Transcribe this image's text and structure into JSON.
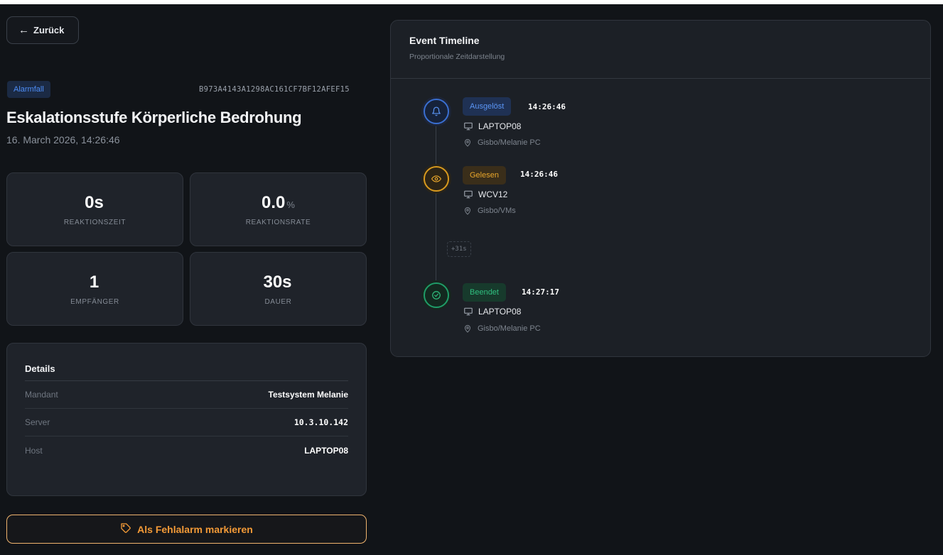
{
  "nav": {
    "back_label": "Zurück"
  },
  "alarm": {
    "type_badge": "Alarmfall",
    "id": "B973A4143A1298AC161CF7BF12AFEF15",
    "title": "Eskalationsstufe Körperliche Bedrohung",
    "date": "16. March 2026, 14:26:46"
  },
  "stats": [
    {
      "value": "0s",
      "unit": "",
      "label": "REAKTIONSZEIT"
    },
    {
      "value": "0.0",
      "unit": "%",
      "label": "REAKTIONSRATE"
    },
    {
      "value": "1",
      "unit": "",
      "label": "EMPFÄNGER"
    },
    {
      "value": "30s",
      "unit": "",
      "label": "DAUER"
    }
  ],
  "details": {
    "title": "Details",
    "rows": [
      {
        "key": "Mandant",
        "value": "Testsystem Melanie"
      },
      {
        "key": "Server",
        "value": "10.3.10.142"
      },
      {
        "key": "Host",
        "value": "LAPTOP08"
      }
    ]
  },
  "actions": {
    "false_alarm_label": "Als Fehlalarm markieren"
  },
  "timeline": {
    "title": "Event Timeline",
    "subtitle": "Proportionale Zeitdarstellung",
    "gap_label": "+31s",
    "events": [
      {
        "status": "Ausgelöst",
        "time": "14:26:46",
        "host": "LAPTOP08",
        "location": "Gisbo/Melanie PC",
        "icon": "bell-icon",
        "color": "#3a6fd1"
      },
      {
        "status": "Gelesen",
        "time": "14:26:46",
        "host": "WCV12",
        "location": "Gisbo/VMs",
        "icon": "eye-icon",
        "color": "#d99a1e"
      },
      {
        "status": "Beendet",
        "time": "14:27:17",
        "host": "LAPTOP08",
        "location": "Gisbo/Melanie PC",
        "icon": "check-circle-icon",
        "color": "#1f9d68"
      }
    ]
  }
}
